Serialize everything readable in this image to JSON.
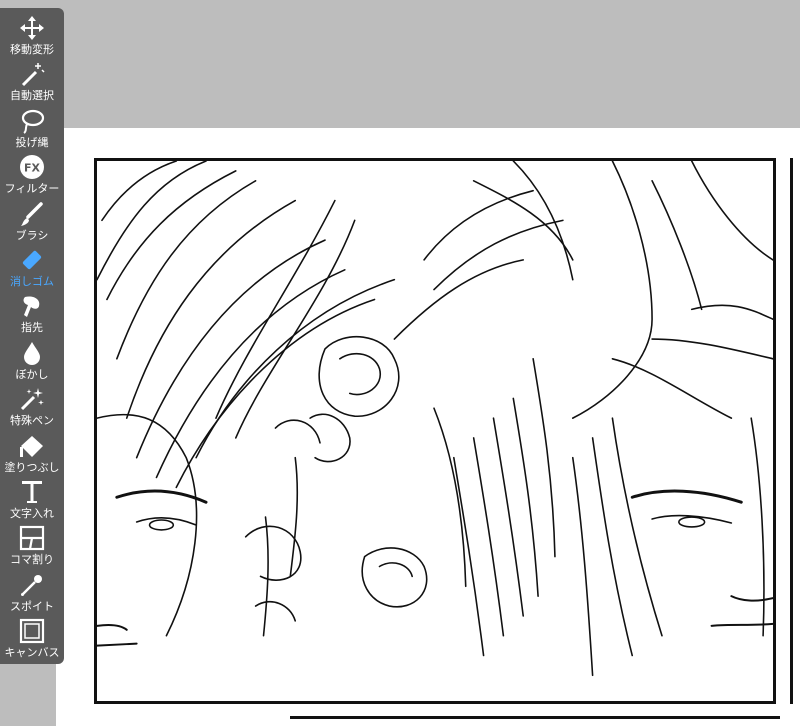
{
  "app": {
    "accent": "#4aa8ff",
    "toolbar_bg": "#5a5a5a"
  },
  "toolbar": {
    "items": [
      {
        "label": "移動変形",
        "icon": "move-transform-icon",
        "active": false
      },
      {
        "label": "自動選択",
        "icon": "magic-wand-icon",
        "active": false
      },
      {
        "label": "投げ縄",
        "icon": "lasso-icon",
        "active": false
      },
      {
        "label": "フィルター",
        "icon": "fx-icon",
        "active": false
      },
      {
        "label": "ブラシ",
        "icon": "brush-icon",
        "active": false
      },
      {
        "label": "消しゴム",
        "icon": "eraser-icon",
        "active": true
      },
      {
        "label": "指先",
        "icon": "smudge-icon",
        "active": false
      },
      {
        "label": "ぼかし",
        "icon": "blur-drop-icon",
        "active": false
      },
      {
        "label": "特殊ペン",
        "icon": "special-pen-icon",
        "active": false
      },
      {
        "label": "塗りつぶし",
        "icon": "fill-bucket-icon",
        "active": false
      },
      {
        "label": "文字入れ",
        "icon": "text-icon",
        "active": false
      },
      {
        "label": "コマ割り",
        "icon": "panel-divide-icon",
        "active": false
      },
      {
        "label": "スポイト",
        "icon": "eyedropper-icon",
        "active": false
      },
      {
        "label": "キャンバス",
        "icon": "canvas-icon",
        "active": false
      }
    ]
  }
}
